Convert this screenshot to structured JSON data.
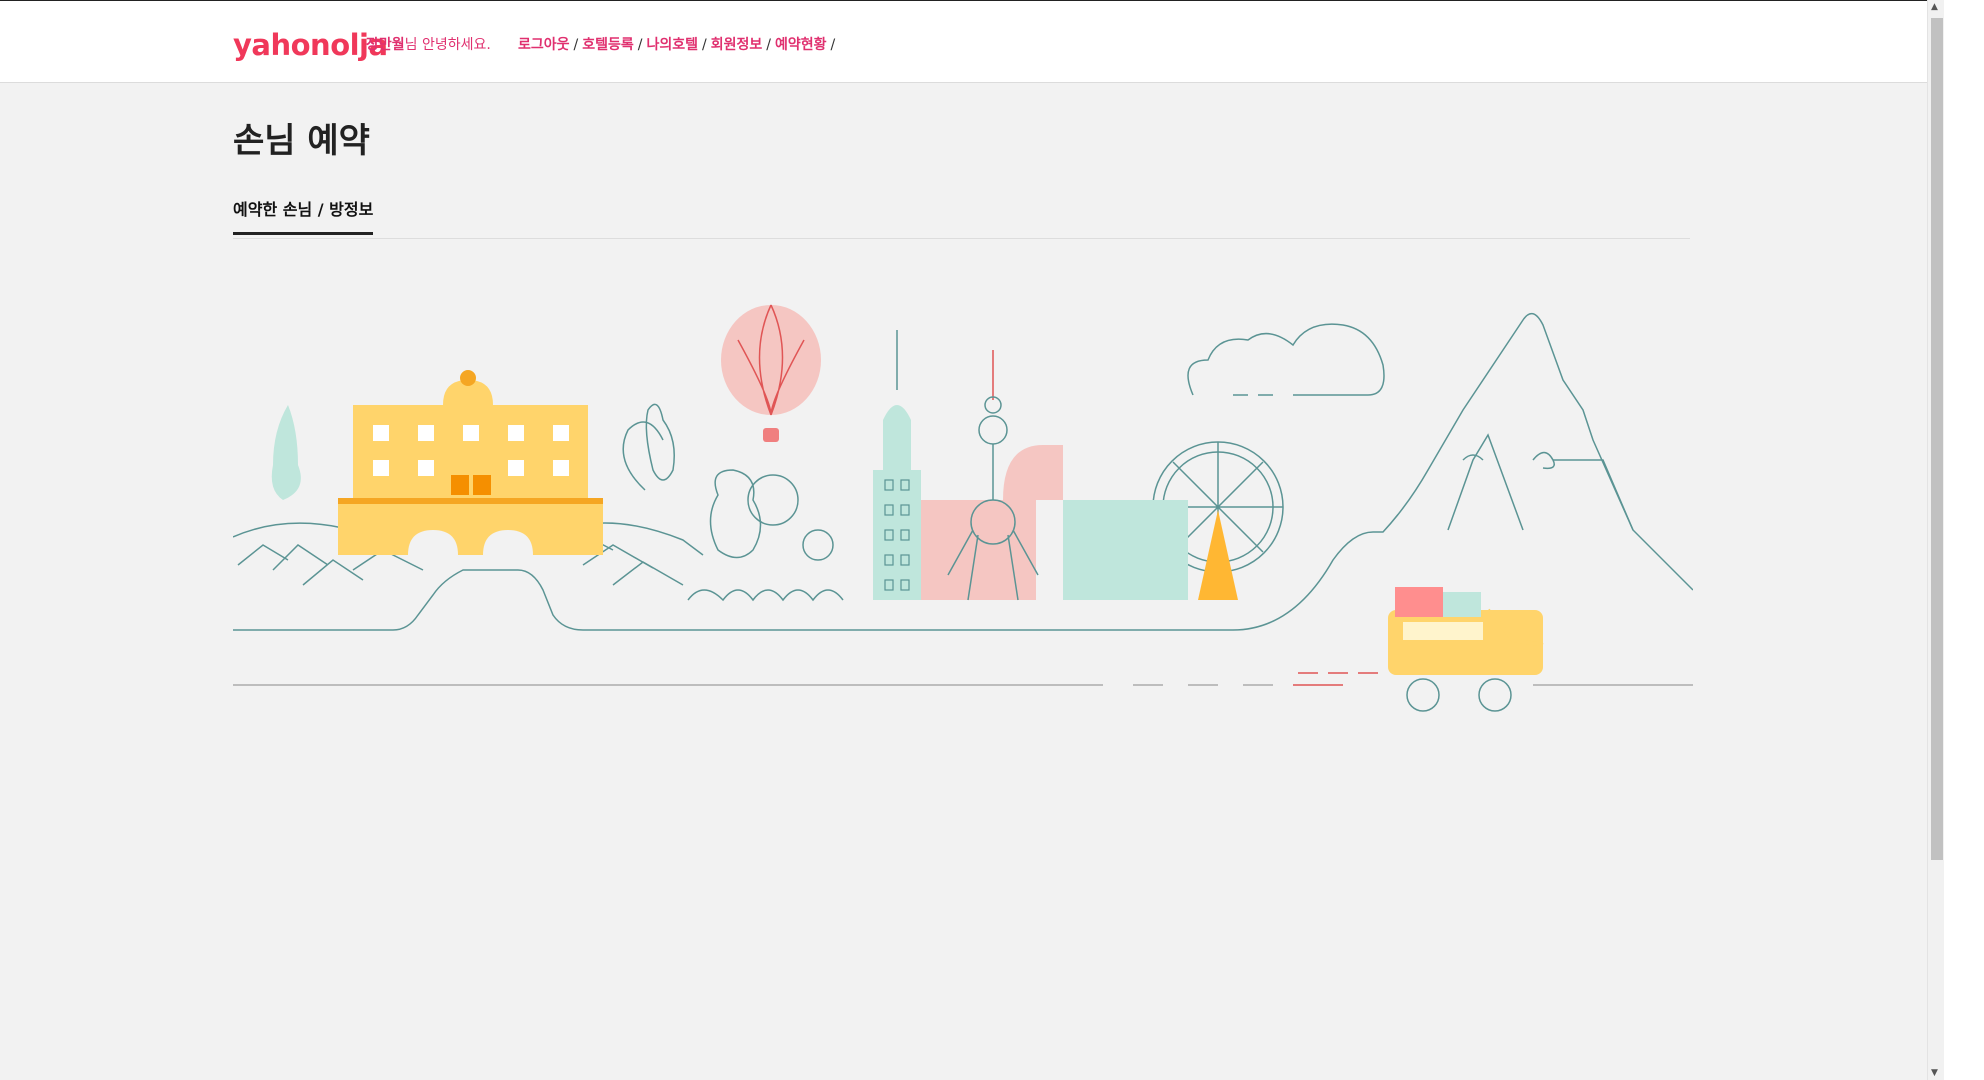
{
  "header": {
    "brand": "yahonolja",
    "greeting_name": "장만월",
    "greeting_suffix": "님 안녕하세요.",
    "nav": [
      {
        "label": "로그아웃"
      },
      {
        "label": "호텔등록"
      },
      {
        "label": "나의호텔"
      },
      {
        "label": "회원정보"
      },
      {
        "label": "예약현황"
      }
    ],
    "separator": "/"
  },
  "main": {
    "title": "손님 예약",
    "tabs": [
      {
        "label": "예약한 손님 / 방정보",
        "active": true
      }
    ]
  },
  "illustration": {
    "icon": "city-travel-illustration"
  },
  "colors": {
    "brand": "#f0385a",
    "nav": "#e0306f",
    "teal": "#5b9494",
    "yellow": "#ffd46b",
    "pink": "#f5c6c2",
    "mint": "#bfe6dc"
  }
}
